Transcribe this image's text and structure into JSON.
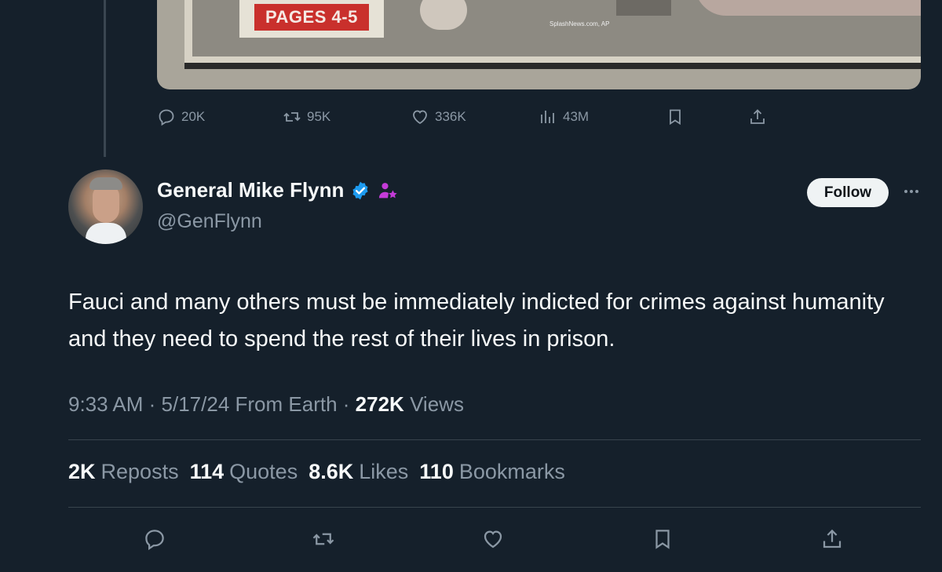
{
  "media": {
    "badge_text": "PAGES 4-5",
    "credit_text": "SplashNews.com, AP"
  },
  "prev_tweet_actions": {
    "replies": "20K",
    "reposts": "95K",
    "likes": "336K",
    "views": "43M"
  },
  "author": {
    "name": "General Mike Flynn",
    "handle": "@GenFlynn",
    "verified_color": "#1d9bf0",
    "affiliate_badge_color": "#c43bd8"
  },
  "follow_label": "Follow",
  "tweet": {
    "text": "Fauci and many others must be immediately indicted for crimes against humanity and they need to spend the rest of their lives in prison.",
    "time": "9:33 AM",
    "date": "5/17/24",
    "location": "From Earth",
    "views_count": "272K",
    "views_label": "Views"
  },
  "stats": [
    {
      "count": "2K",
      "label": "Reposts"
    },
    {
      "count": "114",
      "label": "Quotes"
    },
    {
      "count": "8.6K",
      "label": "Likes"
    },
    {
      "count": "110",
      "label": "Bookmarks"
    }
  ],
  "icons": {
    "reply": "reply-icon",
    "repost": "repost-icon",
    "like": "heart-icon",
    "views": "views-icon",
    "bookmark": "bookmark-icon",
    "share": "share-icon",
    "more": "more-icon"
  },
  "colors": {
    "background": "#15202b",
    "text_primary": "#f7f9f9",
    "text_secondary": "#8b98a5",
    "divider": "#38444d"
  }
}
